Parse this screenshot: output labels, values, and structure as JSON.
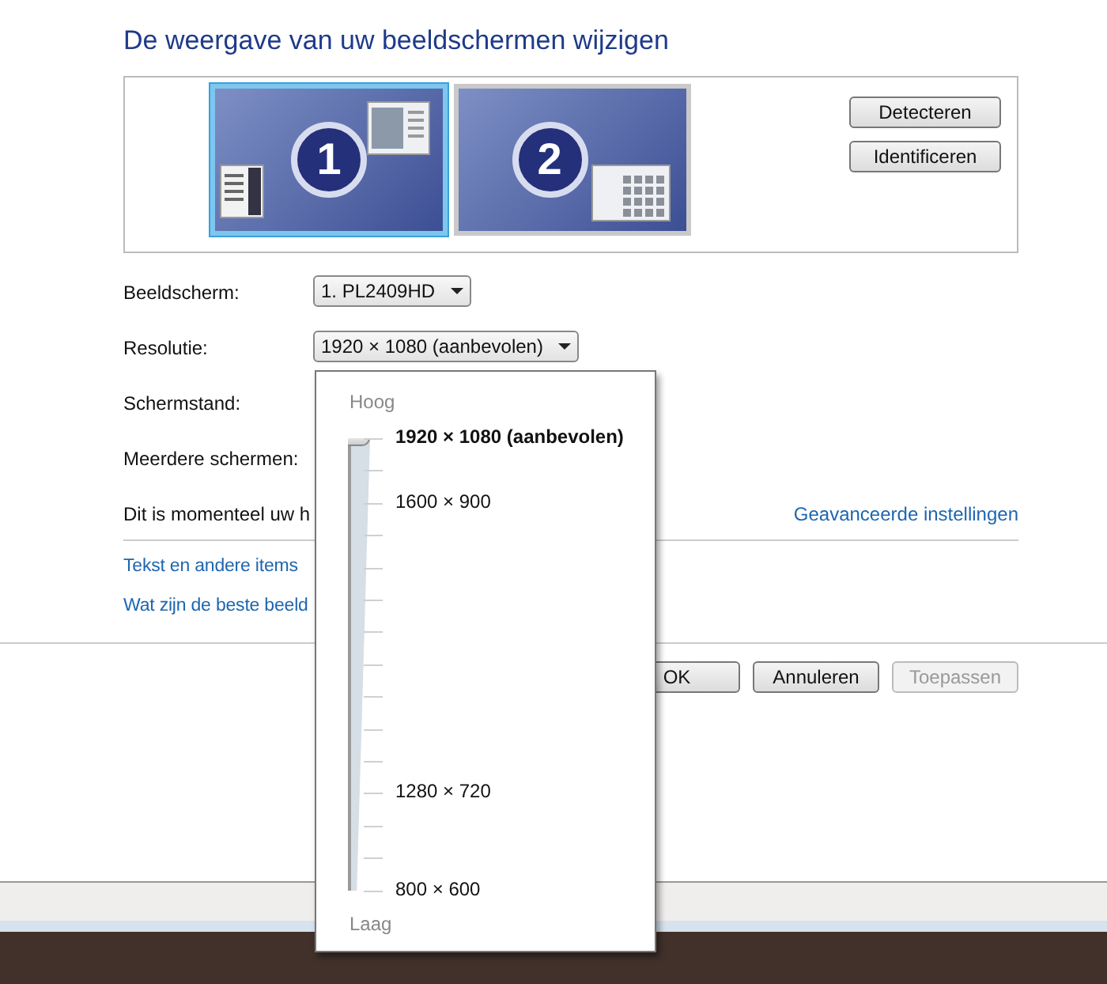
{
  "title": "De weergave van uw beeldschermen wijzigen",
  "monitors": [
    {
      "number": "1",
      "selected": true
    },
    {
      "number": "2",
      "selected": false
    }
  ],
  "side_buttons": [
    "Detecteren",
    "Identificeren"
  ],
  "fields": [
    {
      "label": "Beeldscherm:",
      "value": "1. PL2409HD"
    },
    {
      "label": "Resolutie:",
      "value": "1920 × 1080 (aanbevolen)"
    },
    {
      "label": "Schermstand:"
    },
    {
      "label": "Meerdere schermen:"
    }
  ],
  "status_text": "Dit is momenteel uw h",
  "advanced_link": "Geavanceerde instellingen",
  "links": [
    "Tekst en andere items",
    "Wat zijn de beste beeld"
  ],
  "buttons": [
    {
      "label": "OK",
      "disabled": false
    },
    {
      "label": "Annuleren",
      "disabled": false
    },
    {
      "label": "Toepassen",
      "disabled": true
    }
  ],
  "resolution_popup": {
    "high_label": "Hoog",
    "low_label": "Laag",
    "level": 1,
    "options": [
      {
        "label": "1920 × 1080 (aanbevolen)",
        "selected": true
      },
      {
        "label": "1600 × 900",
        "selected": false
      },
      {
        "label": "1280 × 720",
        "selected": false
      },
      {
        "label": "800 × 600",
        "selected": false
      }
    ]
  }
}
